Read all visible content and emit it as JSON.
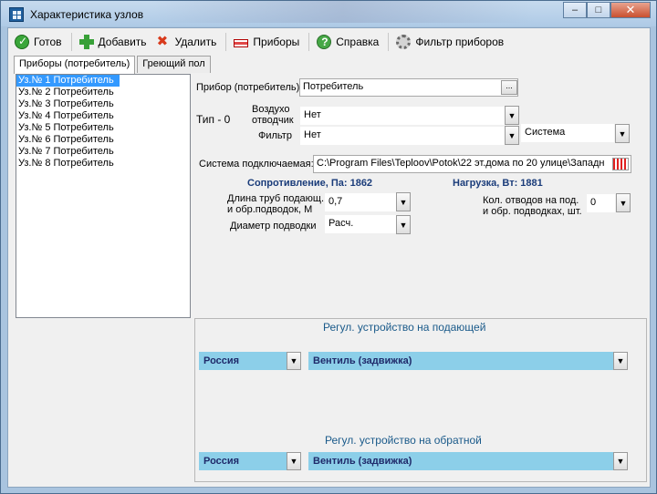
{
  "window": {
    "title": "Характеристика узлов",
    "minimize": "–",
    "maximize": "□",
    "close": "✕"
  },
  "toolbar": {
    "done": "Готов",
    "add": "Добавить",
    "delete": "Удалить",
    "devices": "Приборы",
    "help": "Справка",
    "filter": "Фильтр приборов"
  },
  "tabs": [
    "Приборы (потребитель)",
    "Греющий пол"
  ],
  "list": [
    "Уз.№ 1 Потребитель",
    "Уз.№ 2 Потребитель",
    "Уз.№ 3 Потребитель",
    "Уз.№ 4 Потребитель",
    "Уз.№ 5 Потребитель",
    "Уз.№ 6 Потребитель",
    "Уз.№ 7 Потребитель",
    "Уз.№ 8 Потребитель"
  ],
  "form": {
    "device_label": "Прибор (потребитель)",
    "device_value": "Потребитель",
    "ellipsis": "...",
    "type_label": "Тип - 0",
    "air_vent_label_1": "Воздухо",
    "air_vent_label_2": "отводчик",
    "air_vent_value": "Нет",
    "filter_label": "Фильтр",
    "filter_value": "Нет",
    "system_value": "Система",
    "connected_system_label": "Система подключаемая:",
    "connected_system_value": "C:\\Program Files\\Teploov\\Potok\\22 эт.дома по 20 улице\\Западн",
    "resistance": "Сопротивление, Па: 1862",
    "load": "Нагрузка, Вт: 1881",
    "pipe_length_label_1": "Длина труб подающ.",
    "pipe_length_label_2": "и обр.подводок,  М",
    "pipe_length_value": "0,7",
    "diameter_label": "Диаметр подводки",
    "diameter_value": "Расч.",
    "bends_label_1": "Кол. отводов на  под.",
    "bends_label_2": "и обр. подводках, шт.",
    "bends_value": "0"
  },
  "regulators": {
    "supply_title": "Регул. устройство на подающей",
    "supply_country": "Россия",
    "supply_device": "Вентиль (задвижка)",
    "return_title": "Регул. устройство на обратной",
    "return_country": "Россия",
    "return_device": "Вентиль (задвижка)"
  },
  "icons": {
    "done": "check-circle-icon",
    "add": "plus-icon",
    "delete": "x-icon",
    "devices": "radiator-icon",
    "help": "question-icon",
    "filter": "gear-icon"
  }
}
